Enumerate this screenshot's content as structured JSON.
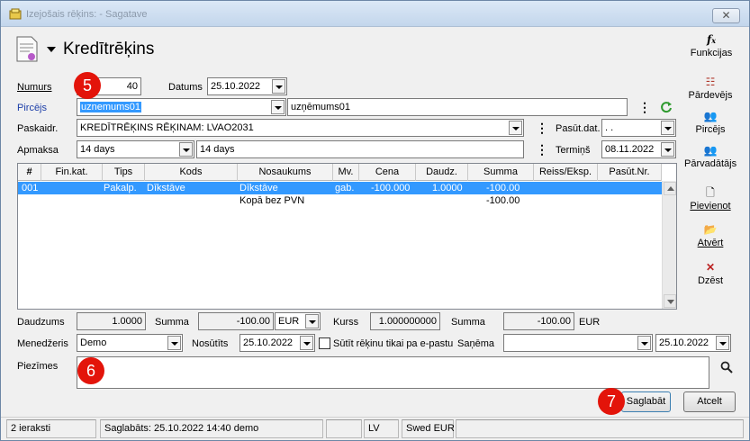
{
  "window": {
    "title": "Izejošais rēķins:  - Sagatave",
    "close_label": "✕"
  },
  "header": {
    "title": "Kredītrēķins",
    "functions_label": "Funkcijas",
    "functions_icon": "fx-icon"
  },
  "form": {
    "numurs_label": "Numurs",
    "numurs_value": "40",
    "datums_label": "Datums",
    "datums_value": "25.10.2022",
    "pircejs_label": "Pircējs",
    "pircejs_code": "uznemums01",
    "pircejs_name": "uzņēmums01",
    "paskaidr_label": "Paskaidr.",
    "paskaidr_value": "KREDĪTRĒĶINS RĒĶINAM: LVAO2031",
    "pasut_dat_label": "Pasūt.dat.",
    "pasut_dat_value": " .  .",
    "apmaksa_label": "Apmaksa",
    "apmaksa_code": "14 days",
    "apmaksa_name": "14 days",
    "termins_label": "Termiņš",
    "termins_value": "08.11.2022"
  },
  "grid": {
    "columns": [
      "#",
      "Fin.kat.",
      "Tips",
      "Kods",
      "Nosaukums",
      "Mv.",
      "Cena",
      "Daudz.",
      "Summa",
      "Reiss/Eksp.",
      "Pasūt.Nr."
    ],
    "rows": [
      {
        "num": "001",
        "fin": "",
        "tips": "Pakalp.",
        "kods": "Dīkstāve",
        "nos": "Dīkstāve",
        "mv": "gab.",
        "cena": "-100.000",
        "daudz": "1.0000",
        "summa": "-100.00",
        "reiss": "",
        "pasut": ""
      }
    ],
    "total_label": "Kopā bez PVN",
    "total_value": "-100.00"
  },
  "totals": {
    "daudzums_label": "Daudzums",
    "daudzums_value": "1.0000",
    "summa_label": "Summa",
    "summa_value": "-100.00",
    "currency": "EUR",
    "kurss_label": "Kurss",
    "kurss_value": "1.000000000",
    "summa2_label": "Summa",
    "summa2_value": "-100.00",
    "currency2": "EUR"
  },
  "bottom": {
    "menedzeris_label": "Menedžeris",
    "menedzeris_value": "Demo",
    "nosutits_label": "Nosūtīts",
    "nosutits_value": "25.10.2022",
    "email_checkbox_label": "Sūtīt rēķinu tikai pa e-pastu",
    "sanema_label": "Saņēma",
    "sanema_value": "",
    "sanema_date": "25.10.2022",
    "piezimes_label": "Piezīmes"
  },
  "side_buttons": [
    {
      "label": "Pārdevējs",
      "icon": "seller-icon"
    },
    {
      "label": "Pircējs",
      "icon": "buyer-icon"
    },
    {
      "label": "Pārvadātājs",
      "icon": "carrier-icon"
    },
    {
      "label": "Pievienot",
      "icon": "add-icon"
    },
    {
      "label": "Atvērt",
      "icon": "open-folder-icon"
    },
    {
      "label": "Dzēst",
      "icon": "delete-icon"
    }
  ],
  "actions": {
    "save_label": "Saglabāt",
    "cancel_label": "Atcelt"
  },
  "callouts": [
    "5",
    "6",
    "7"
  ],
  "statusbar": {
    "records": "2 ieraksti",
    "saved": "Saglabāts: 25.10.2022 14:40 demo",
    "lang": "LV",
    "currency": "Swed EUR"
  },
  "colors": {
    "selection": "#3399ff",
    "callout": "#e3140a",
    "link": "#1c3ea8"
  }
}
